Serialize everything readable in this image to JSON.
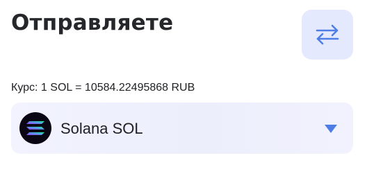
{
  "header": {
    "title": "Отправляете",
    "swap_icon": "swap-arrows-icon"
  },
  "rate": {
    "text": "Курс: 1 SOL = 10584.22495868 RUB"
  },
  "currency_select": {
    "selected_label": "Solana SOL",
    "coin_icon": "solana-logo-icon",
    "dropdown_icon": "caret-down-icon"
  },
  "colors": {
    "accent": "#4e7de6",
    "swap_button_bg": "#e5e9fd",
    "select_bg": "#eceefc",
    "text": "#26272b"
  }
}
